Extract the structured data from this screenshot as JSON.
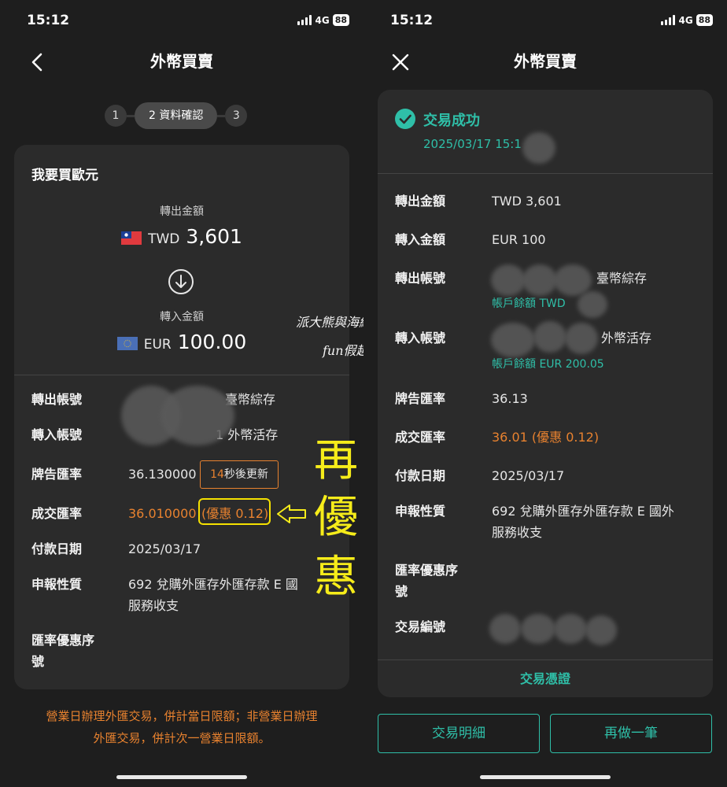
{
  "left": {
    "status": {
      "time": "15:12",
      "network": "4G",
      "battery": "88"
    },
    "nav": {
      "title": "外幣買賣"
    },
    "stepper": {
      "step1": "1",
      "step2": "2 資料確認",
      "step3": "3"
    },
    "card": {
      "title": "我要買歐元",
      "out_label": "轉出金額",
      "out_currency": "TWD",
      "out_amount": "3,601",
      "in_label": "轉入金額",
      "in_currency": "EUR",
      "in_amount": "100.00",
      "rows": {
        "out_account_label": "轉出帳號",
        "out_account_value": "臺幣綜存",
        "in_account_label": "轉入帳號",
        "in_account_value": "1 外幣活存",
        "board_rate_label": "牌告匯率",
        "board_rate_value": "36.130000",
        "refresh_seconds": "14",
        "refresh_text": "秒後更新",
        "deal_rate_label": "成交匯率",
        "deal_rate_value": "36.010000",
        "deal_discount": "(優惠 0.12)",
        "pay_date_label": "付款日期",
        "pay_date_value": "2025/03/17",
        "declare_label": "申報性質",
        "declare_line1": "692 兌購外匯存外匯存款 E 國",
        "declare_line2": "服務收支",
        "promo_label_line1": "匯率優惠序",
        "promo_label_line2": "號"
      }
    },
    "note": {
      "line1": "營業日辦理外匯交易，併計當日限額；非營業日辦理",
      "line2": "外匯交易，併計次一營業日限額。"
    },
    "annotation": {
      "c1": "再",
      "c2": "優",
      "c3": "惠"
    },
    "watermark": {
      "line1": "派大熊與海綿羊",
      "line2": "fun假趣"
    }
  },
  "right": {
    "status": {
      "time": "15:12",
      "network": "4G",
      "battery": "88"
    },
    "nav": {
      "title": "外幣買賣"
    },
    "success": {
      "title": "交易成功",
      "time": "2025/03/17 15:1"
    },
    "rows": {
      "out_amount_label": "轉出金額",
      "out_amount_value": "TWD 3,601",
      "in_amount_label": "轉入金額",
      "in_amount_value": "EUR 100",
      "out_account_label": "轉出帳號",
      "out_account_value": "臺幣綜存",
      "out_balance": "帳戶餘額 TWD",
      "in_account_label": "轉入帳號",
      "in_account_value": "外幣活存",
      "in_balance": "帳戶餘額 EUR 200.05",
      "board_rate_label": "牌告匯率",
      "board_rate_value": "36.13",
      "deal_rate_label": "成交匯率",
      "deal_rate_value": "36.01 (優惠 0.12)",
      "pay_date_label": "付款日期",
      "pay_date_value": "2025/03/17",
      "declare_label": "申報性質",
      "declare_line1": "692 兌購外匯存外匯存款 E 國外",
      "declare_line2": "服務收支",
      "promo_label_line1": "匯率優惠序",
      "promo_label_line2": "號",
      "txn_no_label": "交易編號"
    },
    "voucher": "交易憑證",
    "buttons": {
      "detail": "交易明細",
      "again": "再做一筆"
    }
  }
}
